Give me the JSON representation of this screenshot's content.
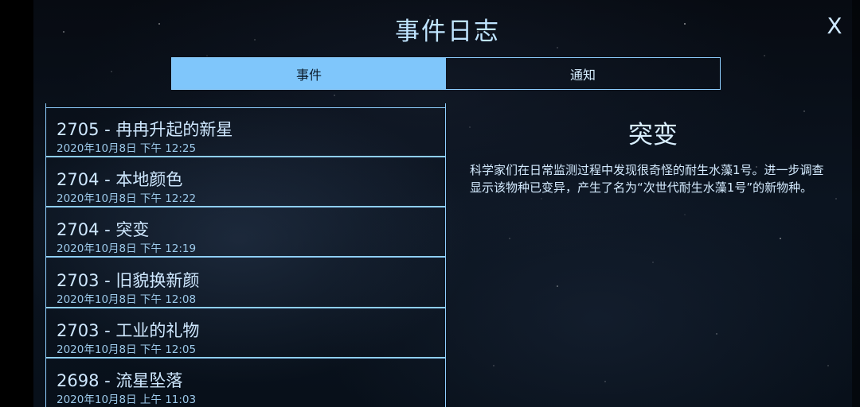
{
  "header": {
    "title": "事件日志",
    "close_label": "X"
  },
  "tabs": [
    {
      "label": "事件",
      "active": true
    },
    {
      "label": "通知",
      "active": false
    }
  ],
  "events": [
    {
      "title": "2705 - 冉冉升起的新星",
      "date": "2020年10月8日 下午 12:25"
    },
    {
      "title": "2704 - 本地颜色",
      "date": "2020年10月8日 下午 12:22"
    },
    {
      "title": "2704 - 突变",
      "date": "2020年10月8日 下午 12:19"
    },
    {
      "title": "2703 - 旧貌换新颜",
      "date": "2020年10月8日 下午 12:08"
    },
    {
      "title": "2703 - 工业的礼物",
      "date": "2020年10月8日 下午 12:05"
    },
    {
      "title": "2698 - 流星坠落",
      "date": "2020年10月8日 上午 11:03"
    }
  ],
  "detail": {
    "title": "突变",
    "body": "科学家们在日常监测过程中发现很奇怪的耐生水藻1号。进一步调查显示该物种已变异，产生了名为“次世代耐生水藻1号”的新物种。"
  },
  "colors": {
    "accent": "#7fc6fb",
    "border": "#8fcfff",
    "text": "#cfe8ff",
    "background": "#0b1420"
  }
}
